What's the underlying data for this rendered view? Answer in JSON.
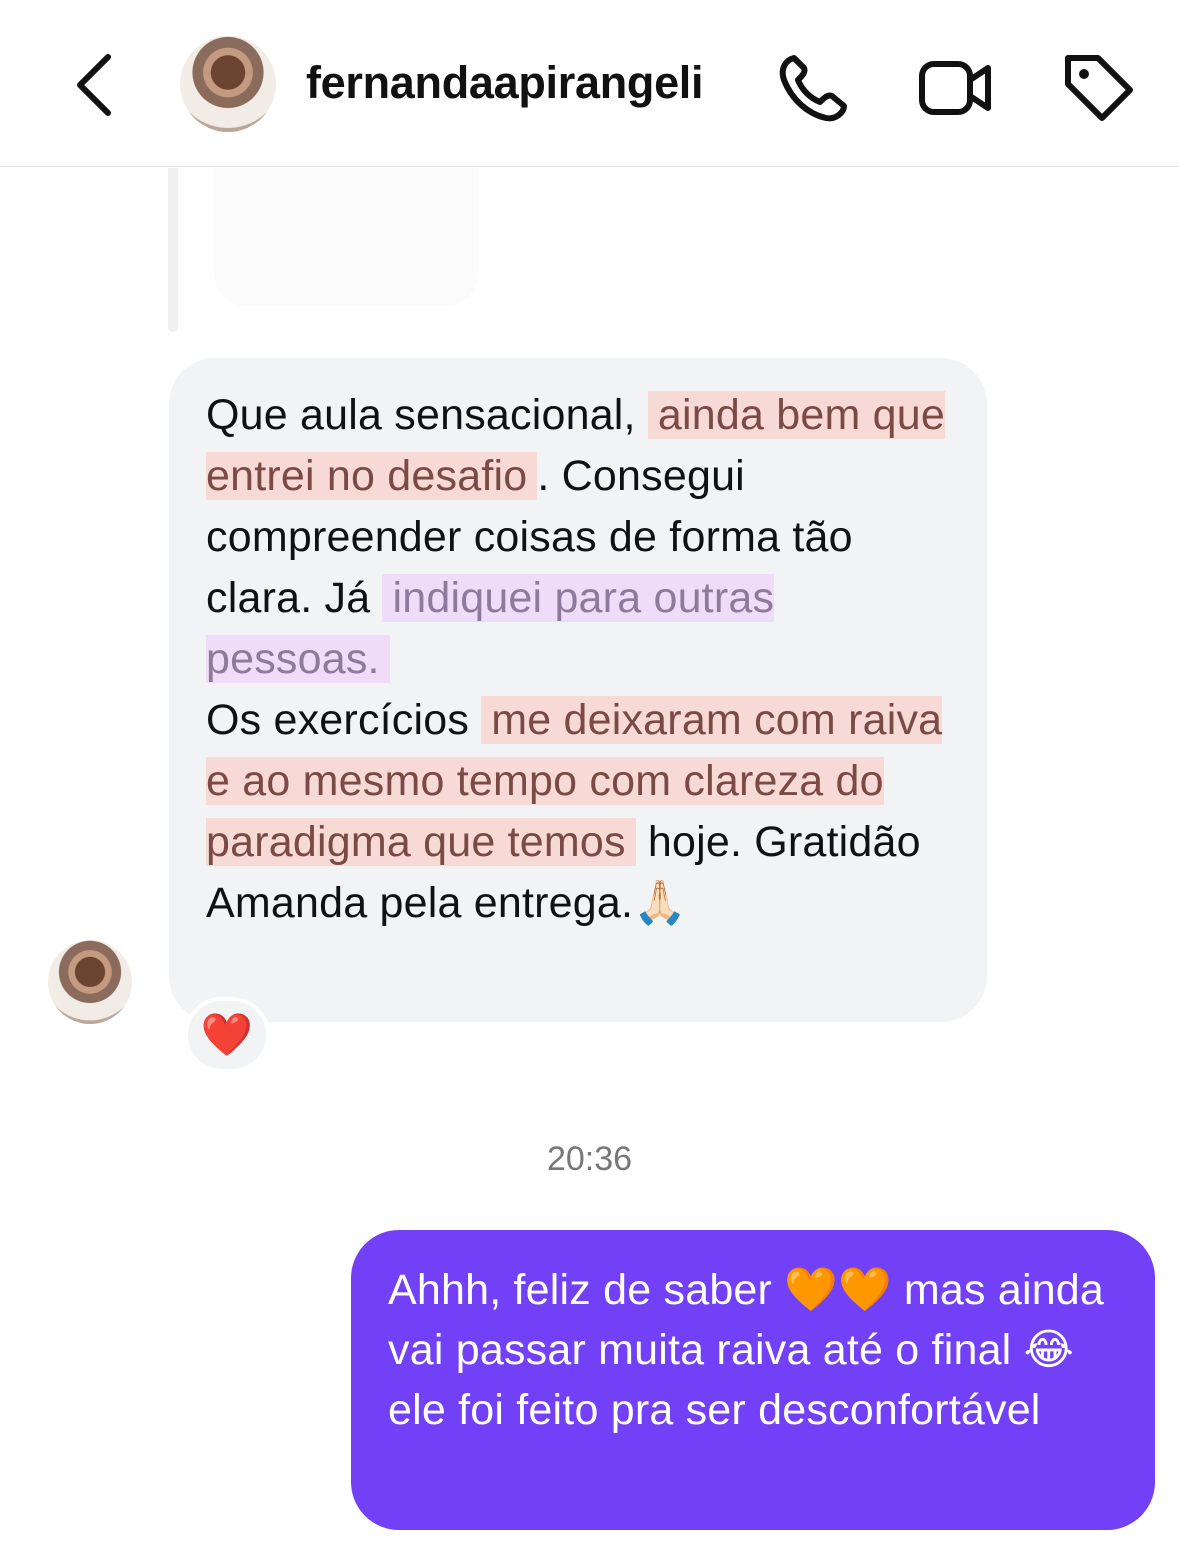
{
  "header": {
    "username": "fernandaapirangeli",
    "icons": [
      "back-chevron-icon",
      "phone-icon",
      "video-camera-icon",
      "tag-icon"
    ]
  },
  "incoming_message": {
    "segments": [
      {
        "text": "Que aula sensacional, ",
        "style": "plain"
      },
      {
        "text": "ainda bem que entrei no desafio",
        "style": "highlight-red"
      },
      {
        "text": ". Consegui compreender coisas de forma tão clara. Já ",
        "style": "plain"
      },
      {
        "text": "indiquei para outras pessoas.",
        "style": "highlight-purple"
      },
      {
        "text": "Os exercícios ",
        "style": "plain"
      },
      {
        "text": "me deixaram com raiva e ao mesmo tempo com clareza do paradigma que temos",
        "style": "highlight-red"
      },
      {
        "text": " hoje. Gratidão Amanda pela entrega.🙏🏻",
        "style": "plain"
      }
    ],
    "reaction": "❤️"
  },
  "timestamp": "20:36",
  "outgoing_message": {
    "text": "Ahhh, feliz de saber 🧡🧡 mas ainda vai passar muita raiva até o final 😂ele foi feito pra ser desconfortável"
  },
  "colors": {
    "outgoing_bubble": "#7140f7",
    "incoming_bubble": "#f2f3f5",
    "highlight_red": "#f7d9d6",
    "highlight_purple": "#efdcf8"
  }
}
